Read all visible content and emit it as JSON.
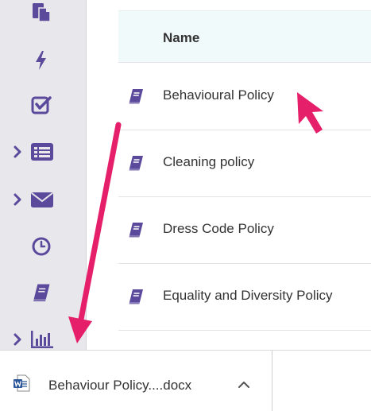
{
  "colors": {
    "accent_purple": "#5b4a9b",
    "annotation_pink": "#e51f6a"
  },
  "sidebar": {
    "items": [
      {
        "icon": "documents-icon",
        "has_chevron": false
      },
      {
        "icon": "lightning-icon",
        "has_chevron": false
      },
      {
        "icon": "checkbox-icon",
        "has_chevron": false
      },
      {
        "icon": "list-icon",
        "has_chevron": true
      },
      {
        "icon": "envelope-icon",
        "has_chevron": true
      },
      {
        "icon": "clock-icon",
        "has_chevron": false
      },
      {
        "icon": "book-icon",
        "has_chevron": false
      },
      {
        "icon": "bar-chart-icon",
        "has_chevron": true
      }
    ]
  },
  "table": {
    "header": "Name",
    "rows": [
      {
        "label": "Behavioural Policy",
        "icon": "book-icon"
      },
      {
        "label": "Cleaning policy",
        "icon": "book-icon"
      },
      {
        "label": "Dress Code Policy",
        "icon": "book-icon"
      },
      {
        "label": "Equality and Diversity Policy",
        "icon": "book-icon"
      }
    ]
  },
  "download_bar": {
    "file_name": "Behaviour Policy....docx",
    "file_icon": "word-document-icon",
    "caret_icon": "chevron-up-icon"
  },
  "annotations": [
    "pink-arrow-cursor",
    "pink-arrow-to-download"
  ]
}
